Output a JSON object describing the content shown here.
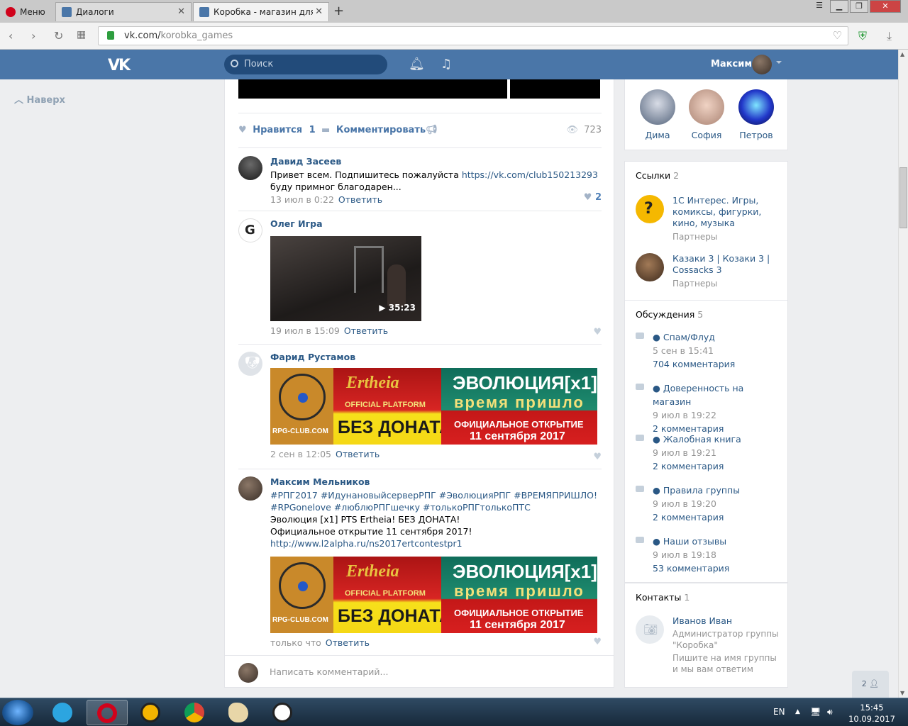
{
  "browser": {
    "menu_label": "Меню",
    "tabs": [
      {
        "title": "Диалоги"
      },
      {
        "title": "Коробка - магазин для ге"
      }
    ],
    "url_host": "vk.com/",
    "url_path": "korobka_games"
  },
  "vk": {
    "logo": "VK",
    "search_placeholder": "Поиск",
    "user_name": "Максим",
    "back_to_top": "Наверх"
  },
  "post": {
    "like_label": "Нравится",
    "like_count": "1",
    "comment_label": "Комментировать",
    "views": "723"
  },
  "comments": [
    {
      "author": "Давид Засеев",
      "text_before": "Привет всем. Подпишитесь пожалуйста ",
      "link": "https://vk.com/club150213293",
      "text_after": " буду примног благодарен...",
      "time": "13 июл в 0:22",
      "reply": "Ответить",
      "likes": "2"
    },
    {
      "author": "Олег Игра",
      "video_duration": "35:23",
      "time": "19 июл в 15:09",
      "reply": "Ответить"
    },
    {
      "author": "Фарид Рустамов",
      "time": "2 сен в 12:05",
      "reply": "Ответить"
    },
    {
      "author": "Максим Мельников",
      "line1": "#РПГ2017 #ИдунановыйсерверРПГ #ЭволюцияРПГ #ВРЕМЯПРИШЛО!",
      "line2": "#RPGonelove #люблюРПГшечку #толькоРПГтолькоПТС",
      "line3": "Эволюция [x1] PTS Ertheia! БЕЗ ДОНАТА!",
      "line4": "Официальное открытие 11 сентября 2017!",
      "link": "http://www.l2alpha.ru/ns2017ertcontestpr1",
      "time": "только что",
      "reply": "Ответить"
    }
  ],
  "banner": {
    "site": "RPG-CLUB.COM",
    "brand": "Ertheia",
    "platform": "OFFICIAL PLATFORM",
    "no_donate": "БЕЗ ДОНАТА",
    "evolution": "ЭВОЛЮЦИЯ[x1]",
    "time_came": "время пришло",
    "opening": "ОФИЦИАЛЬНОЕ ОТКРЫТИЕ",
    "date": "11 сентября 2017"
  },
  "write_placeholder": "Написать комментарий...",
  "sidebar": {
    "friends": [
      {
        "name": "Дима"
      },
      {
        "name": "София"
      },
      {
        "name": "Петров"
      }
    ],
    "links_title": "Ссылки",
    "links_count": "2",
    "links": [
      {
        "title": "1С Интерес. Игры, комиксы, фигурки, кино, музыка",
        "sub": "Партнеры"
      },
      {
        "title": "Казаки 3 | Козаки 3 | Cossacks 3",
        "sub": "Партнеры"
      }
    ],
    "discussions_title": "Обсуждения",
    "discussions_count": "5",
    "discussions": [
      {
        "title": "● Спам/Флуд",
        "date": "5 сен в 15:41",
        "comments": "704 комментария"
      },
      {
        "title": "● Доверенность на магазин",
        "date": "9 июл в 19:22",
        "comments": "2 комментария"
      },
      {
        "title": "● Жалобная книга",
        "date": "9 июл в 19:21",
        "comments": "2 комментария"
      },
      {
        "title": "● Правила группы",
        "date": "9 июл в 19:20",
        "comments": "2 комментария"
      },
      {
        "title": "● Наши отзывы",
        "date": "9 июл в 19:18",
        "comments": "53 комментария"
      }
    ],
    "contacts_title": "Контакты",
    "contacts_count": "1",
    "contact": {
      "name": "Иванов Иван",
      "role": "Администратор группы \"Коробка\"",
      "note": "Пишите на имя группы и мы вам ответим"
    }
  },
  "online_pill": "2",
  "taskbar": {
    "lang": "EN",
    "time": "15:45",
    "date": "10.09.2017"
  }
}
